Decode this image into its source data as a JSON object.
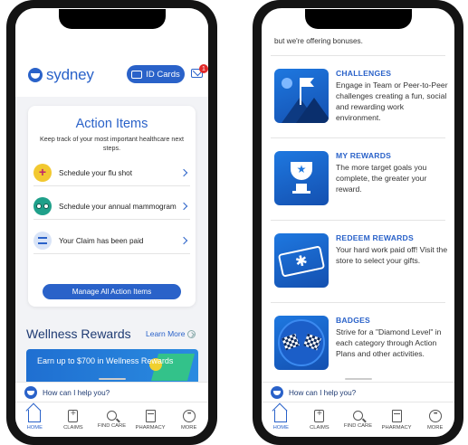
{
  "left": {
    "logo": "sydney",
    "id_cards": "ID Cards",
    "mail_badge": "1",
    "action_items": {
      "title": "Action Items",
      "subtitle": "Keep track of your most important healthcare next steps.",
      "items": [
        {
          "label": "Schedule your flu shot",
          "icon": "flu-shot-icon"
        },
        {
          "label": "Schedule your annual mammogram",
          "icon": "mammogram-icon"
        },
        {
          "label": "Your Claim has been paid",
          "icon": "claim-icon"
        }
      ],
      "manage_label": "Manage All Action Items"
    },
    "wellness": {
      "title": "Wellness Rewards",
      "learn_more": "Learn More",
      "banner_text": "Earn up to $700 in Wellness Rewards"
    }
  },
  "right": {
    "cut_text": "but we're offering bonuses.",
    "features": [
      {
        "title": "CHALLENGES",
        "desc": "Engage in Team or Peer-to-Peer challenges creating a fun, social and rewarding work environment."
      },
      {
        "title": "MY REWARDS",
        "desc": "The more target goals you complete, the greater your reward."
      },
      {
        "title": "REDEEM REWARDS",
        "desc": "Your hard work paid off! Visit the store to select your gifts."
      },
      {
        "title": "BADGES",
        "desc": "Strive for a \"Diamond Level\" in each category through Action Plans and other activities."
      }
    ]
  },
  "chat": {
    "prompt": "How can I help you?"
  },
  "tabs": [
    "HOME",
    "CLAIMS",
    "FIND CARE",
    "PHARMACY",
    "MORE"
  ],
  "colors": {
    "brand": "#2a62c9",
    "active_tab": "HOME"
  }
}
